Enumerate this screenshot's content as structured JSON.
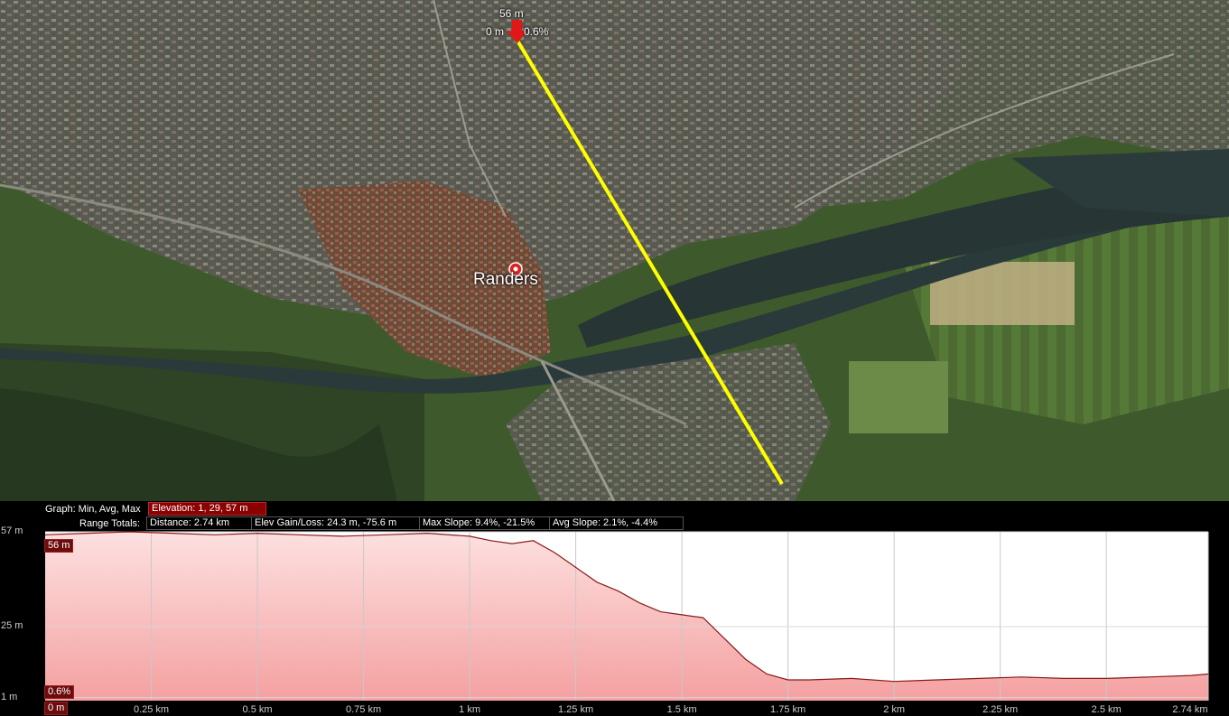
{
  "map": {
    "place_label": "Randers",
    "marker": {
      "icon": "red-arrow-marker-icon",
      "elevation": "56 m",
      "distance": "0 m",
      "slope": "0.6%"
    },
    "path_color": "#ffff00",
    "pin_color": "#e02020"
  },
  "profile": {
    "graph_label": "Graph: Min, Avg, Max",
    "elevation_stat": "Elevation: 1, 29, 57 m",
    "range_totals_label": "Range Totals:",
    "distance": "Distance: 2.74 km",
    "elev_gain_loss": "Elev Gain/Loss: 24.3 m, -75.6 m",
    "max_slope": "Max Slope: 9.4%, -21.5%",
    "avg_slope": "Avg Slope: 2.1%, -4.4%",
    "cursor_elevation": "56 m",
    "cursor_slope": "0.6%",
    "start_distance": "0 m"
  },
  "chart_data": {
    "type": "area",
    "x_unit": "km",
    "y_unit": "m",
    "ylim": [
      0,
      57
    ],
    "xlim": [
      0,
      2.74
    ],
    "y_ticks": [
      "57 m",
      "25 m",
      "1 m"
    ],
    "y_tick_values": [
      57,
      25,
      1
    ],
    "x_ticks": [
      "0.25 km",
      "0.5 km",
      "0.75 km",
      "1 km",
      "1.25 km",
      "1.5 km",
      "1.75 km",
      "2 km",
      "2.25 km",
      "2.5 km",
      "2.74 km"
    ],
    "x_tick_values": [
      0.25,
      0.5,
      0.75,
      1.0,
      1.25,
      1.5,
      1.75,
      2.0,
      2.25,
      2.5,
      2.74
    ],
    "series": [
      {
        "color": "#8b1a1a",
        "fill": "#f4a0a0",
        "x": [
          0,
          0.1,
          0.2,
          0.3,
          0.4,
          0.5,
          0.6,
          0.7,
          0.8,
          0.9,
          1.0,
          1.05,
          1.1,
          1.15,
          1.2,
          1.25,
          1.3,
          1.35,
          1.4,
          1.45,
          1.5,
          1.55,
          1.6,
          1.65,
          1.7,
          1.75,
          1.8,
          1.9,
          2.0,
          2.1,
          2.2,
          2.3,
          2.4,
          2.5,
          2.6,
          2.7,
          2.74
        ],
        "y": [
          56,
          56.5,
          57,
          56.5,
          56,
          56.5,
          56,
          55.5,
          56,
          56.5,
          55.5,
          54,
          53,
          54,
          50,
          45,
          40,
          37,
          33,
          30,
          29,
          28,
          21,
          14,
          9,
          7,
          7,
          7.5,
          6.5,
          7,
          7.5,
          8,
          7.5,
          7.5,
          8,
          8.5,
          9
        ]
      }
    ]
  }
}
